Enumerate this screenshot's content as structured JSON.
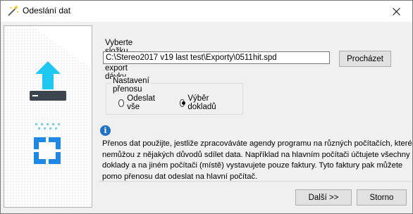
{
  "window": {
    "title": "Odeslání dat",
    "close_glyph": "✕"
  },
  "form": {
    "folder_label": "Vyberte složku pro export dávky",
    "path_value": "C:\\Stereo2017 v19 last test\\Exporty\\0511hit.spd",
    "browse_label": "Procházet"
  },
  "transfer": {
    "legend": "Nastavení přenosu",
    "options": [
      {
        "label": "Odeslat vše",
        "checked": false
      },
      {
        "label": "Výběr dokladů",
        "checked": true
      }
    ]
  },
  "info": {
    "icon": "info-icon",
    "text": "Přenos dat použijte, jestliže zpracováváte agendy programu na různých počítačích, které nemůžou z nějakých důvodů sdílet data. Například na hlavním počítači účtujete všechny doklady a na jiném počítači (místě) vystavujete pouze faktury. Tyto faktury pak můžete pomo přenosu dat odeslat na hlavní počítač."
  },
  "footer": {
    "next_label": "Další >>",
    "cancel_label": "Storno"
  },
  "colors": {
    "accent": "#1e88e5",
    "upload_arrow": "#1ec8f0",
    "tray": "#3c4450"
  }
}
